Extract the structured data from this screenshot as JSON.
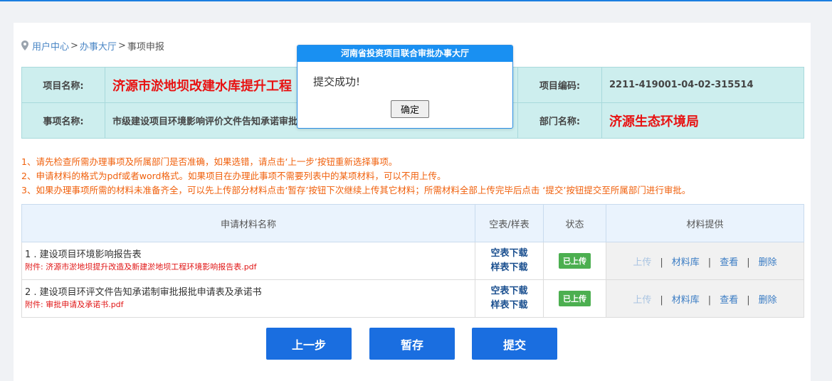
{
  "breadcrumb": {
    "item1": "用户中心",
    "sep1": ">",
    "item2": "办事大厅",
    "sep2": ">",
    "item3": "事项申报"
  },
  "info": {
    "project_name_label": "项目名称:",
    "project_name": "济源市淤地坝改建水库提升工程",
    "project_code_label": "项目编码:",
    "project_code": "2211-419001-04-02-315514",
    "item_name_label": "事项名称:",
    "item_name": "市级建设项目环境影响评价文件告知承诺审批",
    "dept_label": "部门名称:",
    "dept": "济源生态环境局"
  },
  "notes": [
    "1、请先检查所需办理事项及所属部门是否准确，如果选错，请点击‘上一步’按钮重新选择事项。",
    "2、申请材料的格式为pdf或者word格式。如果项目在办理此事项不需要列表中的某项材料，可以不用上传。",
    "3、如果办理事项所需的材料未准备齐全，可以先上传部分材料点击‘暂存’按钮下次继续上传其它材料；所需材料全部上传完毕后点击 ‘提交’按钮提交至所属部门进行审批。"
  ],
  "materials": {
    "headers": [
      "申请材料名称",
      "空表/样表",
      "状态",
      "材料提供"
    ],
    "rows": [
      {
        "title": "1 . 建设项目环境影响报告表",
        "attachment": "附件: 济源市淤地坝提升改造及新建淤地坝工程环境影响报告表.pdf",
        "blank_download": "空表下载",
        "sample_download": "样表下载",
        "status": "已上传",
        "upload": "上传",
        "library": "材料库",
        "view": "查看",
        "delete": "删除"
      },
      {
        "title": "2 . 建设项目环评文件告知承诺制审批报批申请表及承诺书",
        "attachment": "附件: 审批申请及承诺书.pdf",
        "blank_download": "空表下载",
        "sample_download": "样表下载",
        "status": "已上传",
        "upload": "上传",
        "library": "材料库",
        "view": "查看",
        "delete": "删除"
      }
    ],
    "divider": "|"
  },
  "buttons": {
    "prev": "上一步",
    "save": "暂存",
    "submit": "提交"
  },
  "dialog": {
    "title": "河南省投资项目联合审批办事大厅",
    "message": "提交成功!",
    "ok": "确定"
  },
  "colors": {
    "accent": "#1a6ee0",
    "status_uploaded": "#4caf50",
    "highlight_red": "#e81212",
    "notes_orange": "#f0600c"
  }
}
